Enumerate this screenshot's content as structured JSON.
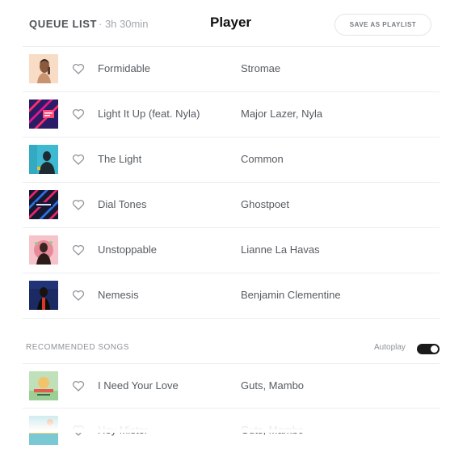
{
  "header": {
    "queue_title": "QUEUE LIST",
    "queue_duration": "· 3h 30min",
    "player_title": "Player",
    "save_button": "SAVE AS PLAYLIST"
  },
  "queue": [
    {
      "title": "Formidable",
      "artist": "Stromae",
      "cover": "formidable-cover-art"
    },
    {
      "title": "Light It Up (feat. Nyla)",
      "artist": "Major Lazer, Nyla",
      "cover": "light-it-up-cover-art"
    },
    {
      "title": "The Light",
      "artist": "Common",
      "cover": "the-light-cover-art"
    },
    {
      "title": "Dial Tones",
      "artist": "Ghostpoet",
      "cover": "dial-tones-cover-art"
    },
    {
      "title": "Unstoppable",
      "artist": "Lianne La Havas",
      "cover": "unstoppable-cover-art"
    },
    {
      "title": "Nemesis",
      "artist": "Benjamin Clementine",
      "cover": "nemesis-cover-art"
    }
  ],
  "recommended": {
    "label": "RECOMMENDED SONGS",
    "autoplay_label": "Autoplay",
    "autoplay_on": true,
    "songs": [
      {
        "title": "I Need Your Love",
        "artist": "Guts, Mambo",
        "cover": "i-need-your-love-cover-art"
      },
      {
        "title": "Hey Mister",
        "artist": "Guts, Mambo",
        "cover": "hey-mister-cover-art"
      }
    ]
  },
  "colors": {
    "text": "#565c62",
    "muted": "#8d9298",
    "divider": "#eceef0",
    "toggle_on": "#1a1a1a"
  }
}
